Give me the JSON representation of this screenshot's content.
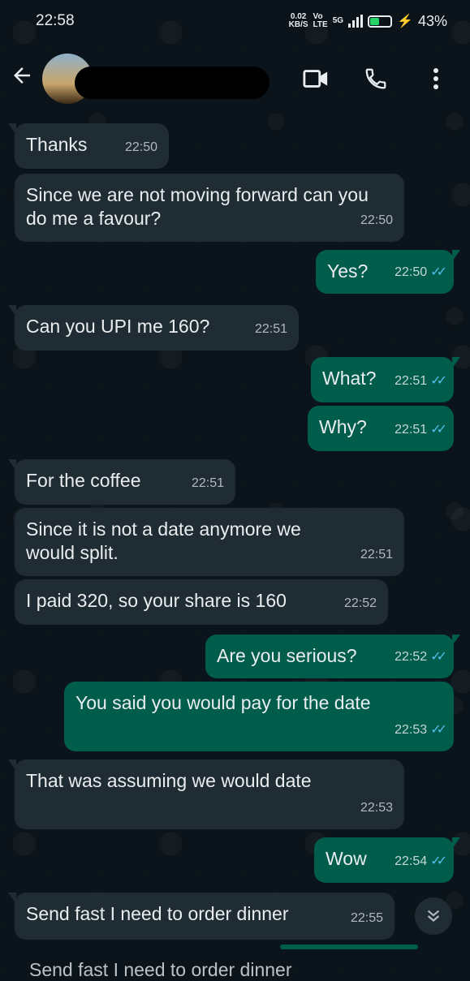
{
  "status_bar": {
    "time": "22:58",
    "net_speed": "0.02",
    "net_unit": "KB/S",
    "volte": "Vo",
    "lte": "LTE",
    "network": "5G",
    "battery": "43%"
  },
  "header": {
    "back_icon": "arrow-left-icon",
    "video_icon": "video-call-icon",
    "call_icon": "phone-icon",
    "menu_icon": "more-vert-icon"
  },
  "messages": [
    {
      "dir": "in",
      "text": "Thanks",
      "time": "22:50"
    },
    {
      "dir": "in",
      "text": "Since we are not moving forward can you do me a favour?",
      "time": "22:50"
    },
    {
      "dir": "out",
      "text": "Yes?",
      "time": "22:50"
    },
    {
      "dir": "in",
      "text": "Can you UPI me 160?",
      "time": "22:51"
    },
    {
      "dir": "out",
      "text": "What?",
      "time": "22:51"
    },
    {
      "dir": "out",
      "text": "Why?",
      "time": "22:51"
    },
    {
      "dir": "in",
      "text": "For the coffee",
      "time": "22:51"
    },
    {
      "dir": "in",
      "text": "Since it is not a date anymore we would split.",
      "time": "22:51"
    },
    {
      "dir": "in",
      "text": "I paid 320, so your share is 160",
      "time": "22:52"
    },
    {
      "dir": "out",
      "text": "Are you serious?",
      "time": "22:52"
    },
    {
      "dir": "out",
      "text": "You said you would pay for the date",
      "time": "22:53"
    },
    {
      "dir": "in",
      "text": "That was assuming we would date",
      "time": "22:53"
    },
    {
      "dir": "out",
      "text": "Wow",
      "time": "22:54"
    },
    {
      "dir": "in",
      "text": "Send fast I need to order dinner",
      "time": "22:55"
    }
  ],
  "cutoff_text": "Send fast I need to order dinner",
  "colors": {
    "incoming": "#202c33",
    "outgoing": "#005c4b",
    "read_ticks": "#53bdeb",
    "battery": "#25d366"
  }
}
